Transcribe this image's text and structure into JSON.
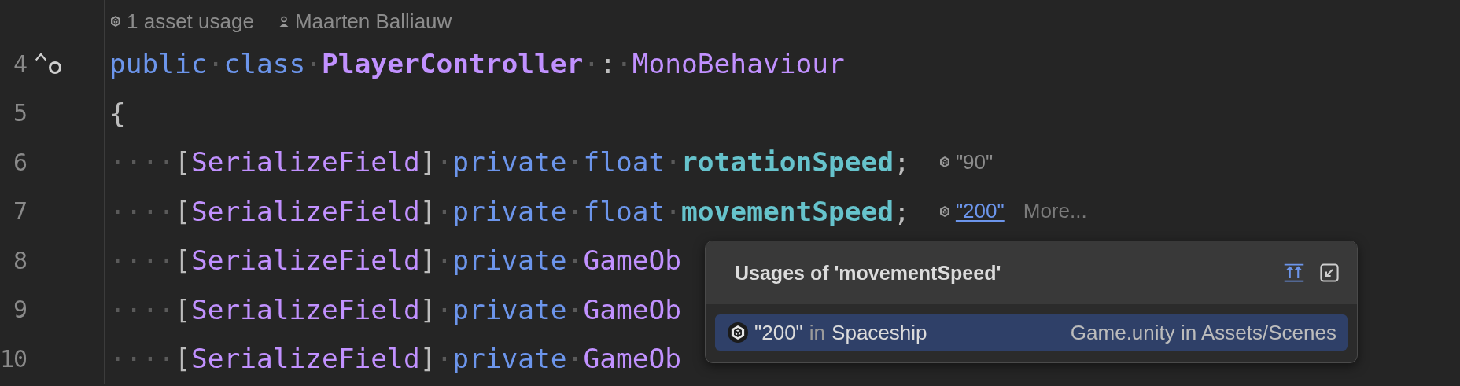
{
  "code_lens": {
    "usages": "1 asset usage",
    "author": "Maarten Balliauw"
  },
  "lines": [
    {
      "number": "4",
      "gutter_icons": true,
      "tokens": [
        {
          "t": "public",
          "kind": "kw"
        },
        {
          "t": "·",
          "kind": "ws"
        },
        {
          "t": "class",
          "kind": "kw"
        },
        {
          "t": "·",
          "kind": "ws"
        },
        {
          "t": "PlayerController",
          "kind": "cls"
        },
        {
          "t": "·",
          "kind": "ws"
        },
        {
          "t": ":",
          "kind": "punct"
        },
        {
          "t": "·",
          "kind": "ws"
        },
        {
          "t": "MonoBehaviour",
          "kind": "type"
        }
      ]
    },
    {
      "number": "5",
      "gutter_icons": false,
      "tokens": [
        {
          "t": "{",
          "kind": "punct"
        }
      ]
    },
    {
      "number": "6",
      "gutter_icons": false,
      "tokens": [
        {
          "t": "····",
          "kind": "ws"
        },
        {
          "t": "[",
          "kind": "punct"
        },
        {
          "t": "SerializeField",
          "kind": "type"
        },
        {
          "t": "]",
          "kind": "punct"
        },
        {
          "t": "·",
          "kind": "ws"
        },
        {
          "t": "private",
          "kind": "kw"
        },
        {
          "t": "·",
          "kind": "ws"
        },
        {
          "t": "float",
          "kind": "kw"
        },
        {
          "t": "·",
          "kind": "ws"
        },
        {
          "t": "rotationSpeed",
          "kind": "field"
        },
        {
          "t": ";",
          "kind": "punct"
        }
      ],
      "hint": {
        "value": "\"90\"",
        "link": false
      }
    },
    {
      "number": "7",
      "gutter_icons": false,
      "tokens": [
        {
          "t": "····",
          "kind": "ws"
        },
        {
          "t": "[",
          "kind": "punct"
        },
        {
          "t": "SerializeField",
          "kind": "type"
        },
        {
          "t": "]",
          "kind": "punct"
        },
        {
          "t": "·",
          "kind": "ws"
        },
        {
          "t": "private",
          "kind": "kw"
        },
        {
          "t": "·",
          "kind": "ws"
        },
        {
          "t": "float",
          "kind": "kw"
        },
        {
          "t": "·",
          "kind": "ws"
        },
        {
          "t": "movementSpeed",
          "kind": "field"
        },
        {
          "t": ";",
          "kind": "punct"
        }
      ],
      "hint": {
        "value": "\"200\"",
        "link": true,
        "more": "More..."
      }
    },
    {
      "number": "8",
      "gutter_icons": false,
      "tokens": [
        {
          "t": "····",
          "kind": "ws"
        },
        {
          "t": "[",
          "kind": "punct"
        },
        {
          "t": "SerializeField",
          "kind": "type"
        },
        {
          "t": "]",
          "kind": "punct"
        },
        {
          "t": "·",
          "kind": "ws"
        },
        {
          "t": "private",
          "kind": "kw"
        },
        {
          "t": "·",
          "kind": "ws"
        },
        {
          "t": "GameOb",
          "kind": "type"
        }
      ]
    },
    {
      "number": "9",
      "gutter_icons": false,
      "tokens": [
        {
          "t": "····",
          "kind": "ws"
        },
        {
          "t": "[",
          "kind": "punct"
        },
        {
          "t": "SerializeField",
          "kind": "type"
        },
        {
          "t": "]",
          "kind": "punct"
        },
        {
          "t": "·",
          "kind": "ws"
        },
        {
          "t": "private",
          "kind": "kw"
        },
        {
          "t": "·",
          "kind": "ws"
        },
        {
          "t": "GameOb",
          "kind": "type"
        }
      ]
    },
    {
      "number": "10",
      "gutter_icons": false,
      "tokens": [
        {
          "t": "····",
          "kind": "ws"
        },
        {
          "t": "[",
          "kind": "punct"
        },
        {
          "t": "SerializeField",
          "kind": "type"
        },
        {
          "t": "]",
          "kind": "punct"
        },
        {
          "t": "·",
          "kind": "ws"
        },
        {
          "t": "private",
          "kind": "kw"
        },
        {
          "t": "·",
          "kind": "ws"
        },
        {
          "t": "GameOb",
          "kind": "type"
        }
      ]
    }
  ],
  "popup": {
    "title": "Usages of 'movementSpeed'",
    "usages": [
      {
        "value": "\"200\"",
        "in": "in",
        "object": "Spaceship",
        "location": "Game.unity in Assets/Scenes",
        "selected": true
      }
    ]
  }
}
